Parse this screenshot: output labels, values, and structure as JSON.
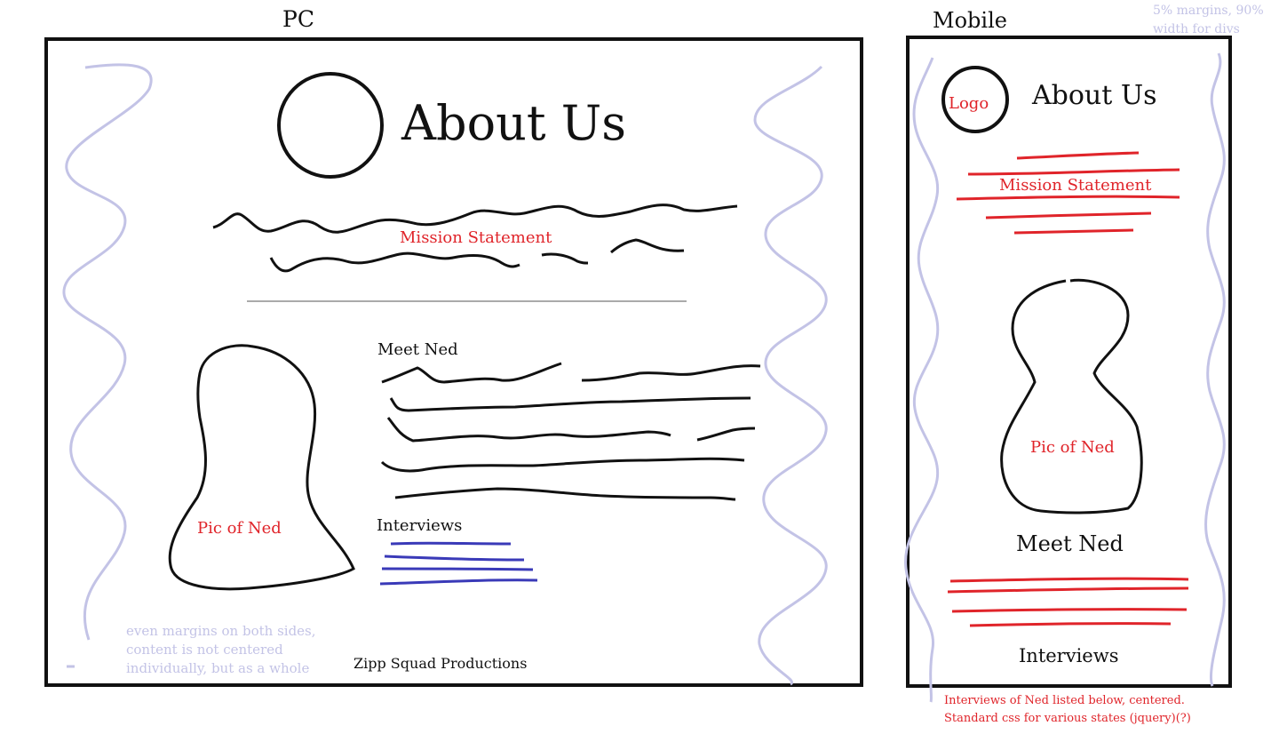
{
  "pc": {
    "heading": "PC",
    "title": "About Us",
    "mission": "Mission Statement",
    "meet": "Meet Ned",
    "pic": "Pic of Ned",
    "interviews": "Interviews",
    "footer": "Zipp Squad Productions",
    "note": [
      "even margins on both sides,",
      "content is not centered",
      "individually, but as a whole"
    ]
  },
  "mobile": {
    "heading": "Mobile",
    "logo": "Logo",
    "title": "About Us",
    "mission": "Mission Statement",
    "pic": "Pic of Ned",
    "meet": "Meet Ned",
    "interviews": "Interviews",
    "note_top": [
      "5% margins, 90%",
      "width for divs"
    ],
    "note_bottom": [
      "Interviews of Ned listed below, centered.",
      "Standard css  for various states (jquery)(?)"
    ]
  },
  "colors": {
    "ink": "#111111",
    "annotation_red": "#e0242a",
    "margin_lavender": "#c3c3e6",
    "link_blue": "#3a3ab8"
  }
}
